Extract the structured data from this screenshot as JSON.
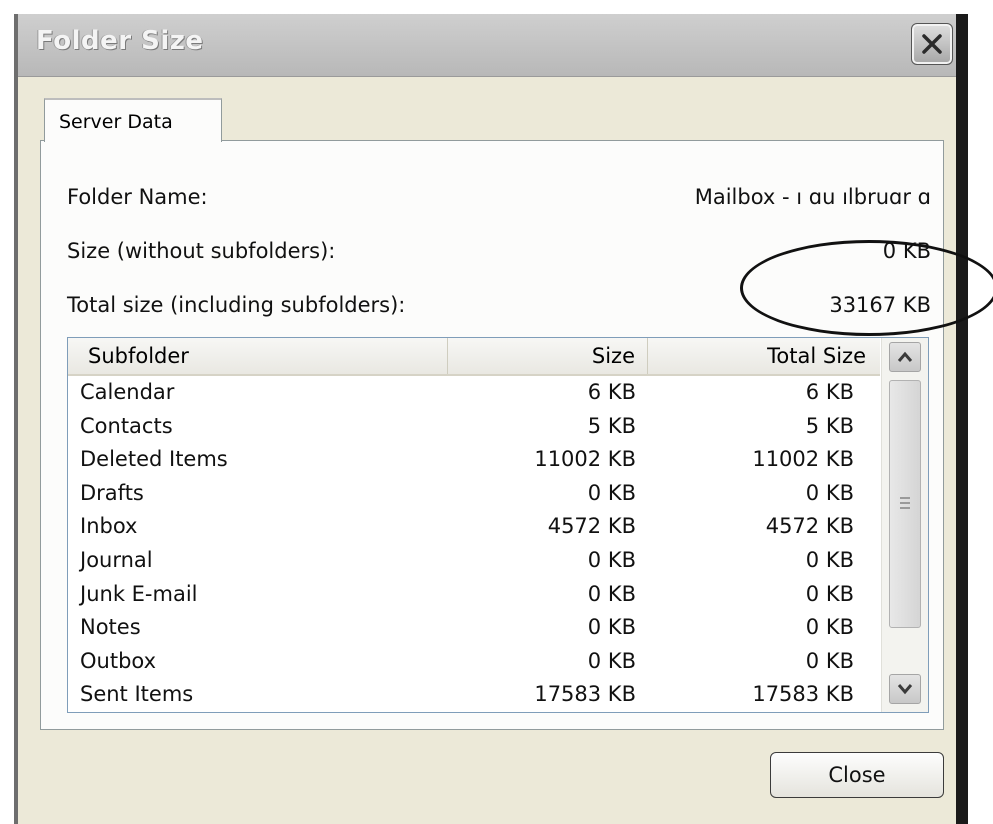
{
  "window": {
    "title": "Folder Size"
  },
  "tab": {
    "label": "Server Data"
  },
  "info": {
    "folder_name_label": "Folder Name:",
    "folder_name_value": "Mailbox - ı ɑu ılbruɑr ɑ",
    "size_label": "Size (without subfolders):",
    "size_value": "0 KB",
    "total_label": "Total size (including subfolders):",
    "total_value": "33167 KB"
  },
  "list": {
    "columns": [
      "Subfolder",
      "Size",
      "Total Size"
    ],
    "rows": [
      {
        "name": "Calendar",
        "size": "6 KB",
        "total": "6 KB"
      },
      {
        "name": "Contacts",
        "size": "5 KB",
        "total": "5 KB"
      },
      {
        "name": "Deleted Items",
        "size": "11002 KB",
        "total": "11002 KB"
      },
      {
        "name": "Drafts",
        "size": "0 KB",
        "total": "0 KB"
      },
      {
        "name": "Inbox",
        "size": "4572 KB",
        "total": "4572 KB"
      },
      {
        "name": "Journal",
        "size": "0 KB",
        "total": "0 KB"
      },
      {
        "name": "Junk E-mail",
        "size": "0 KB",
        "total": "0 KB"
      },
      {
        "name": "Notes",
        "size": "0 KB",
        "total": "0 KB"
      },
      {
        "name": "Outbox",
        "size": "0 KB",
        "total": "0 KB"
      },
      {
        "name": "Sent Items",
        "size": "17583 KB",
        "total": "17583 KB"
      }
    ]
  },
  "buttons": {
    "close_label": "Close"
  },
  "icons": {
    "close": "close-icon",
    "scroll_up": "chevron-up-icon",
    "scroll_down": "chevron-down-icon",
    "grip": "scroll-grip-icon"
  },
  "colors": {
    "dialog_bg": "#ece9d8",
    "panel_bg": "#fcfcfb",
    "title_bg": "#c4c4c4",
    "annotation": "#111111"
  }
}
